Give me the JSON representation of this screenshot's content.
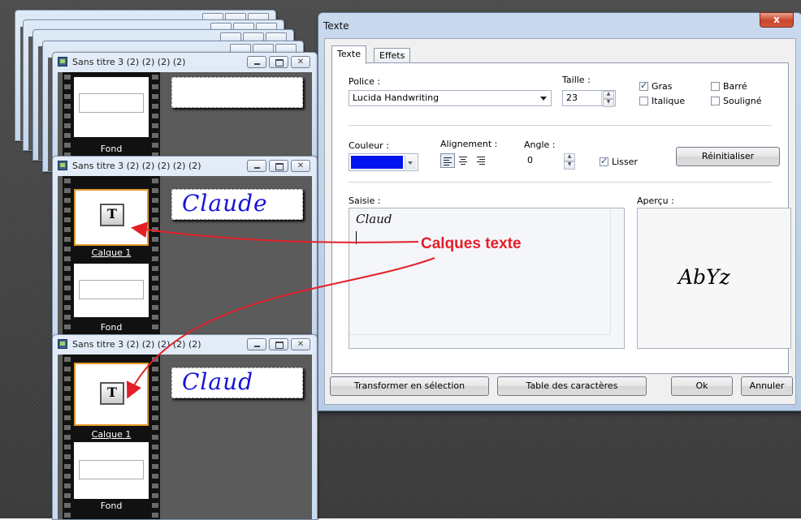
{
  "child_windows": [
    {
      "title": "Sans titre 3 (2) (2) (2) (2)",
      "layers": [
        {
          "label": "Fond",
          "selected": false
        }
      ],
      "preview_text": ""
    },
    {
      "title": "Sans titre 3 (2) (2) (2) (2) (2)",
      "layers": [
        {
          "label": "Calque 1",
          "selected": true
        },
        {
          "label": "Fond",
          "selected": false
        }
      ],
      "preview_text": "Claude"
    },
    {
      "title": "Sans titre 3 (2) (2) (2) (2) (2)",
      "layers": [
        {
          "label": "Calque 1",
          "selected": true
        },
        {
          "label": "Fond",
          "selected": false
        }
      ],
      "preview_text": "Claud"
    }
  ],
  "dialog": {
    "title": "Texte",
    "close_glyph": "x",
    "tabs": [
      {
        "label": "Texte",
        "active": true
      },
      {
        "label": "Effets",
        "active": false
      }
    ],
    "police": {
      "label": "Police :",
      "value": "Lucida Handwriting"
    },
    "taille": {
      "label": "Taille :",
      "value": "23"
    },
    "styles": [
      {
        "label": "Gras",
        "checked": true
      },
      {
        "label": "Barré",
        "checked": false
      },
      {
        "label": "Italique",
        "checked": false
      },
      {
        "label": "Souligné",
        "checked": false
      }
    ],
    "couleur": {
      "label": "Couleur :",
      "value": "#0014f0"
    },
    "alignement": {
      "label": "Alignement :",
      "options": [
        "left",
        "center",
        "right"
      ],
      "selected": "left"
    },
    "angle": {
      "label": "Angle :",
      "value": "0"
    },
    "lisser": {
      "label": "Lisser",
      "checked": true
    },
    "reinitialiser": "Réinitialiser",
    "saisie": {
      "label": "Saisie :",
      "value": "Claud"
    },
    "apercu": {
      "label": "Aperçu :",
      "sample": "AbYz"
    },
    "buttons": {
      "transformer": "Transformer en sélection",
      "table": "Table des caractères",
      "ok": "Ok",
      "annuler": "Annuler"
    }
  },
  "annotation": {
    "text": "Calques texte",
    "color": "#e3202a"
  }
}
